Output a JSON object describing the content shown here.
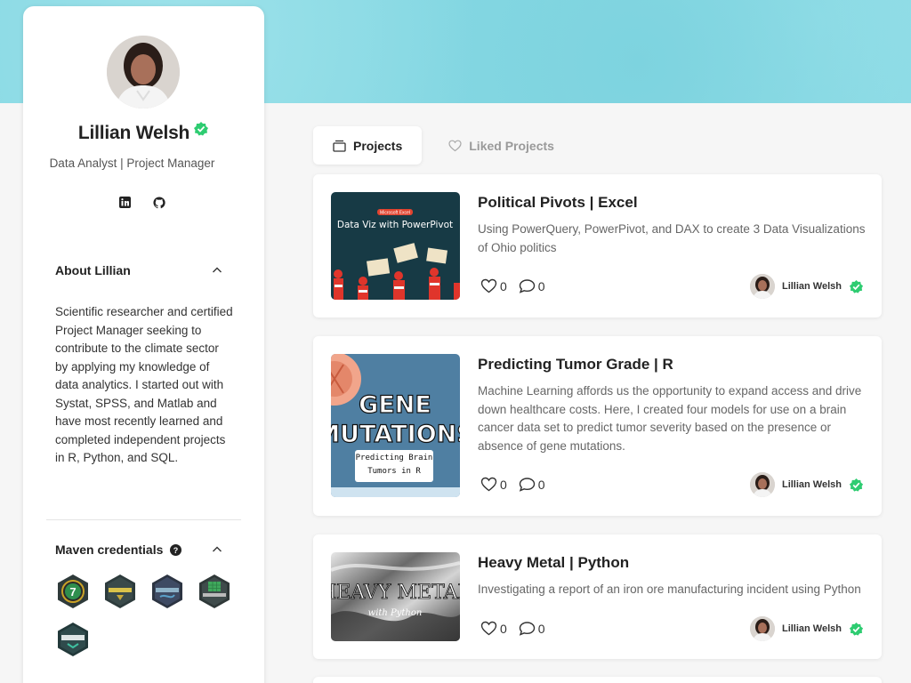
{
  "profile": {
    "name": "Lillian Welsh",
    "title": "Data Analyst | Project Manager"
  },
  "socials": [
    {
      "icon": "linkedin-icon"
    },
    {
      "icon": "github-icon"
    }
  ],
  "about": {
    "heading": "About Lillian",
    "text": "Scientific researcher and certified Project Manager seeking to contribute to the climate sector by applying my knowledge of data analytics. I started out with Systat, SPSS, and Matlab and have most recently learned and completed independent projects in R, Python, and SQL."
  },
  "credentials": {
    "heading": "Maven credentials",
    "badges": [
      {
        "icon": "badge-7-icon"
      },
      {
        "icon": "badge-python-icon"
      },
      {
        "icon": "badge-mysql-icon"
      },
      {
        "icon": "badge-pivot-table-icon"
      },
      {
        "icon": "badge-power-query-icon"
      }
    ]
  },
  "tabs": {
    "projects": "Projects",
    "liked": "Liked Projects"
  },
  "projects": [
    {
      "title": "Political Pivots | Excel",
      "description": "Using PowerQuery, PowerPivot, and DAX to create 3 Data Visualizations of Ohio politics",
      "likes": "0",
      "comments": "0",
      "author": "Lillian Welsh",
      "thumb_text": "Data Viz with PowerPivot",
      "thumb_tag": "Microsoft Excel"
    },
    {
      "title": "Predicting Tumor Grade | R",
      "description": "Machine Learning affords us the opportunity to expand access and drive down healthcare costs. Here, I created four models for use on a brain cancer data set to predict tumor severity based on the presence or absence of gene mutations.",
      "likes": "0",
      "comments": "0",
      "author": "Lillian Welsh",
      "thumb_line1": "GENE",
      "thumb_line2": "MUTATIONS",
      "thumb_sub": "Predicting Brain Tumors in R"
    },
    {
      "title": "Heavy Metal | Python",
      "description": "Investigating a report of an iron ore manufacturing incident using Python",
      "likes": "0",
      "comments": "0",
      "author": "Lillian Welsh",
      "thumb_text": "HEAVY METAL",
      "thumb_sub": "with Python"
    }
  ],
  "colors": {
    "banner": "#86d8e3",
    "verified": "#2ecc71",
    "card": "#ffffff"
  }
}
